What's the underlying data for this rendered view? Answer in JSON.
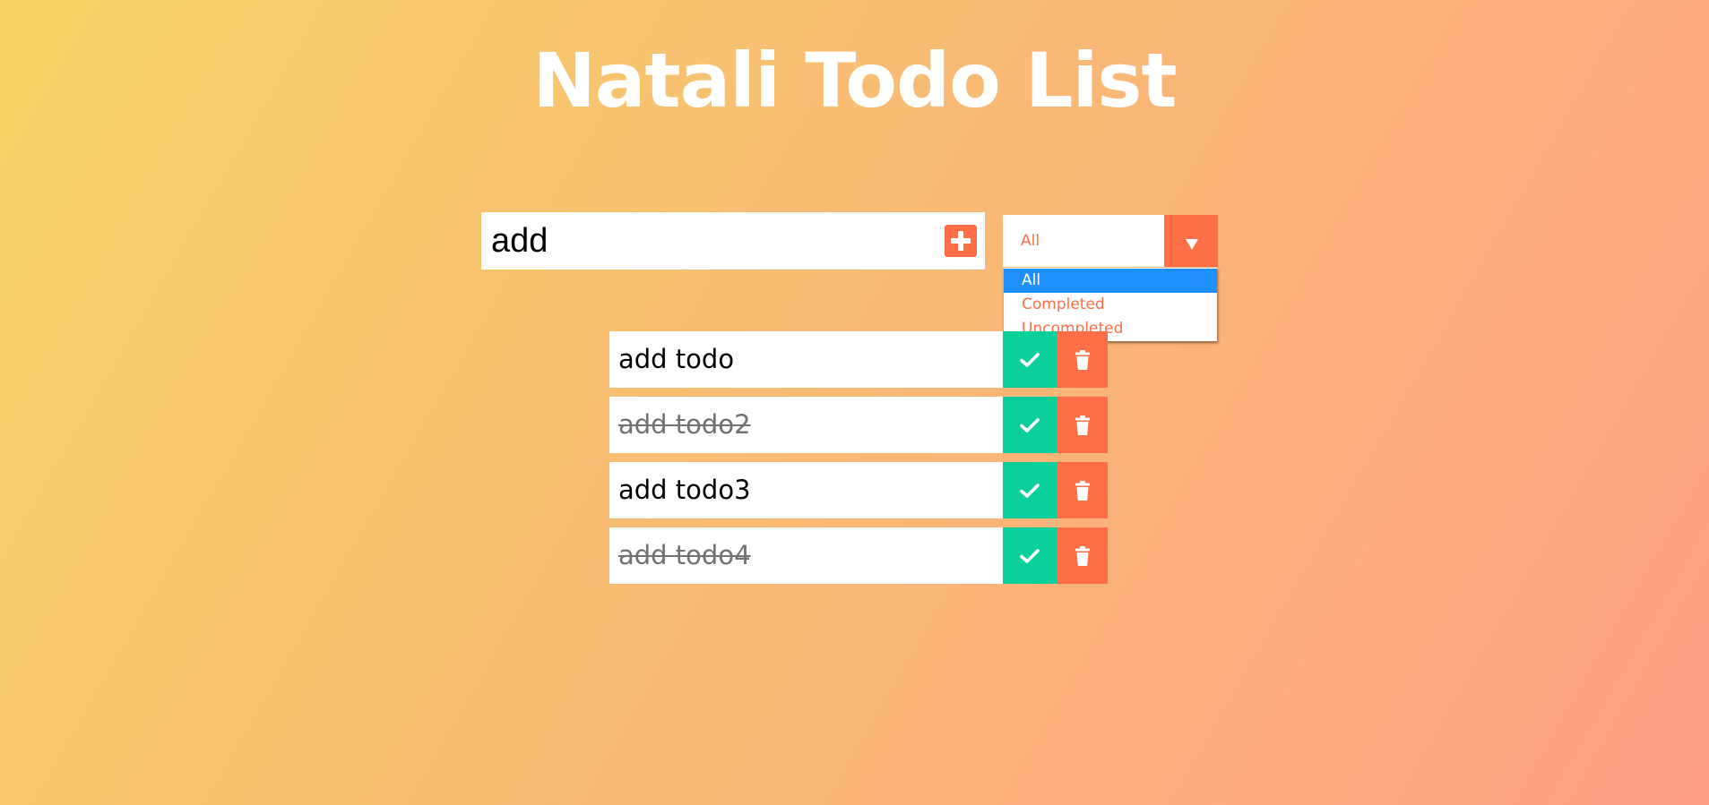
{
  "header": {
    "title": "Natali Todo List"
  },
  "add_form": {
    "input_value": "add",
    "add_icon": "plus-square-icon"
  },
  "filter": {
    "selected": "All",
    "options": [
      "All",
      "Completed",
      "Uncompleted"
    ],
    "highlighted_option": "All",
    "arrow_icon": "caret-down-icon"
  },
  "todos": [
    {
      "text": "add todo",
      "completed": false
    },
    {
      "text": "add todo2",
      "completed": true
    },
    {
      "text": "add todo3",
      "completed": false
    },
    {
      "text": "add todo4",
      "completed": true
    }
  ],
  "icons": {
    "complete": "check-icon",
    "delete": "trash-icon"
  },
  "colors": {
    "gradient_start": "#f6d365",
    "gradient_end": "#fda085",
    "accent": "#ff6f47",
    "complete_green": "#0bd09b",
    "selected_option": "#1e90ff"
  }
}
